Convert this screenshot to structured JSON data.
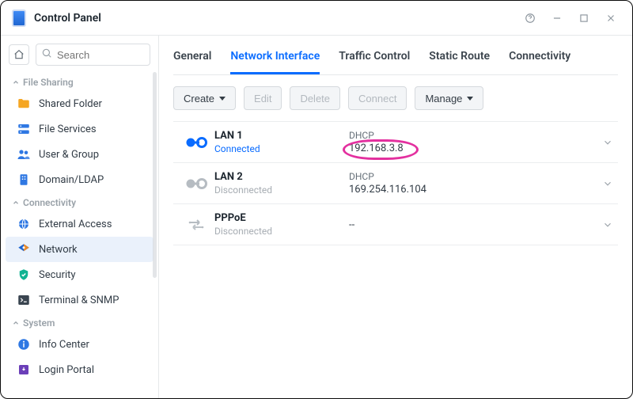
{
  "window": {
    "title": "Control Panel"
  },
  "search": {
    "placeholder": "Search"
  },
  "sidebar": {
    "groups": [
      {
        "label": "File Sharing",
        "items": [
          {
            "label": "Shared Folder",
            "icon": "folder",
            "color": "#f5a623"
          },
          {
            "label": "File Services",
            "icon": "services",
            "color": "#2f78e3"
          },
          {
            "label": "User & Group",
            "icon": "users",
            "color": "#2f78e3"
          },
          {
            "label": "Domain/LDAP",
            "icon": "domain",
            "color": "#2f78e3"
          }
        ]
      },
      {
        "label": "Connectivity",
        "items": [
          {
            "label": "External Access",
            "icon": "globe",
            "color": "#2f78e3"
          },
          {
            "label": "Network",
            "icon": "network",
            "color": "#e98a29",
            "active": true
          },
          {
            "label": "Security",
            "icon": "shield",
            "color": "#11b392"
          },
          {
            "label": "Terminal & SNMP",
            "icon": "terminal",
            "color": "#3a4550"
          }
        ]
      },
      {
        "label": "System",
        "items": [
          {
            "label": "Info Center",
            "icon": "info",
            "color": "#2f78e3"
          },
          {
            "label": "Login Portal",
            "icon": "portal",
            "color": "#6b3fb8"
          }
        ]
      }
    ]
  },
  "tabs": [
    {
      "label": "General"
    },
    {
      "label": "Network Interface",
      "active": true
    },
    {
      "label": "Traffic Control"
    },
    {
      "label": "Static Route"
    },
    {
      "label": "Connectivity"
    }
  ],
  "toolbar": {
    "create": "Create",
    "edit": "Edit",
    "delete": "Delete",
    "connect": "Connect",
    "manage": "Manage"
  },
  "interfaces": [
    {
      "name": "LAN 1",
      "status": "Connected",
      "statusClass": "connected",
      "mode": "DHCP",
      "ip": "192.168.3.8",
      "iconColor": "#0a6cff",
      "highlight": true
    },
    {
      "name": "LAN 2",
      "status": "Disconnected",
      "statusClass": "disconnected",
      "mode": "DHCP",
      "ip": "169.254.116.104",
      "iconColor": "#b6bcc2"
    },
    {
      "name": "PPPoE",
      "status": "Disconnected",
      "statusClass": "disconnected",
      "mode": "",
      "ip": "--",
      "iconType": "arrows",
      "iconColor": "#b6bcc2"
    }
  ],
  "highlightColor": "#e3309f"
}
